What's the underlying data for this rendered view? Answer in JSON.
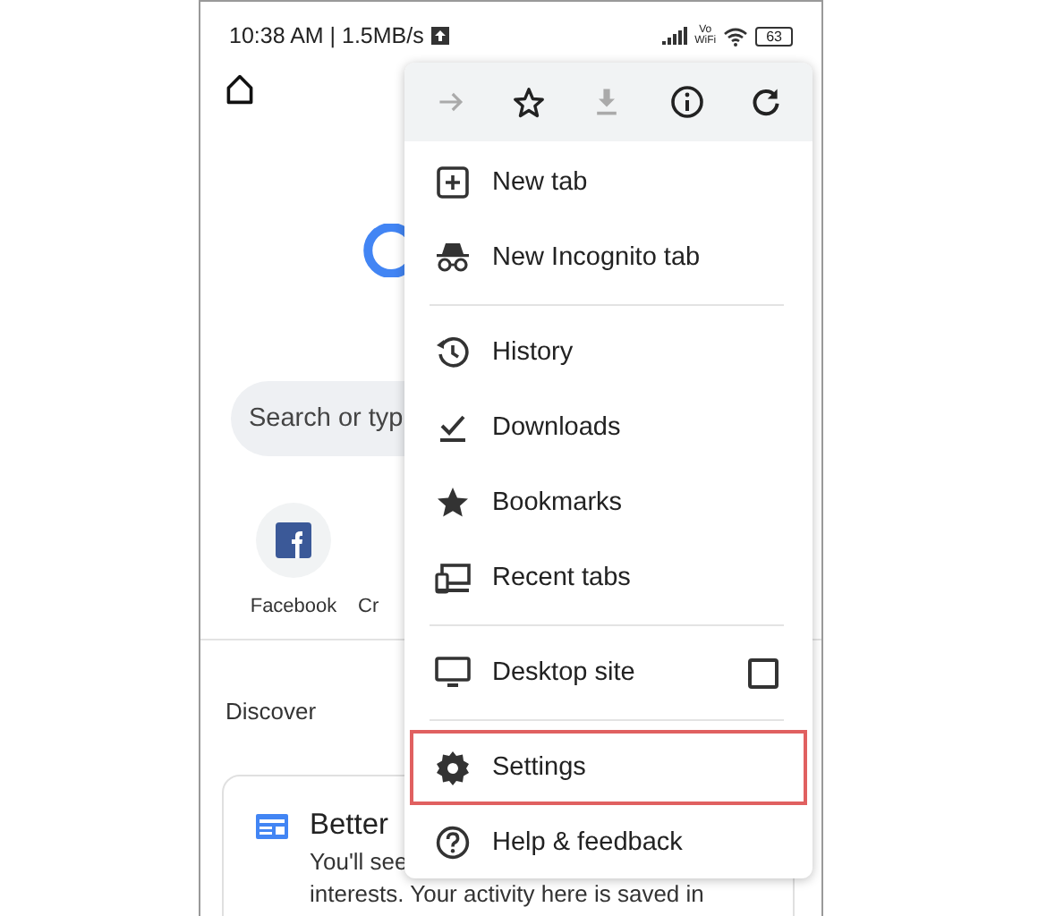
{
  "status_bar": {
    "time_speed": "10:38 AM | 1.5MB/s",
    "network_label": "Vo\nWiFi",
    "battery": "63"
  },
  "search": {
    "placeholder": "Search or typ"
  },
  "shortcuts": [
    {
      "label": "Facebook",
      "kind": "facebook"
    },
    {
      "label": "Cr",
      "kind": "blank"
    }
  ],
  "discover": {
    "heading": "Discover"
  },
  "card": {
    "title": "Better",
    "lines": [
      "You'll see",
      "interests. Your activity here is saved in"
    ]
  },
  "menu": {
    "toolbar": [
      {
        "kind": "forward",
        "disabled": true
      },
      {
        "kind": "star",
        "disabled": false
      },
      {
        "kind": "download",
        "disabled": true
      },
      {
        "kind": "info",
        "disabled": false
      },
      {
        "kind": "reload",
        "disabled": false
      }
    ],
    "items": [
      {
        "label": "New tab",
        "kind": "newtab",
        "highlighted": false
      },
      {
        "label": "New Incognito tab",
        "kind": "incognito",
        "highlighted": false,
        "divider_after": true
      },
      {
        "label": "History",
        "kind": "history",
        "highlighted": false
      },
      {
        "label": "Downloads",
        "kind": "downloads",
        "highlighted": false
      },
      {
        "label": "Bookmarks",
        "kind": "bookmarks",
        "highlighted": false
      },
      {
        "label": "Recent tabs",
        "kind": "recent",
        "highlighted": false,
        "divider_after": true
      },
      {
        "label": "Desktop site",
        "kind": "desktop",
        "highlighted": false,
        "checked": false,
        "divider_after": true
      },
      {
        "label": "Settings",
        "kind": "settings",
        "highlighted": true
      },
      {
        "label": "Help & feedback",
        "kind": "help",
        "highlighted": false
      }
    ]
  }
}
